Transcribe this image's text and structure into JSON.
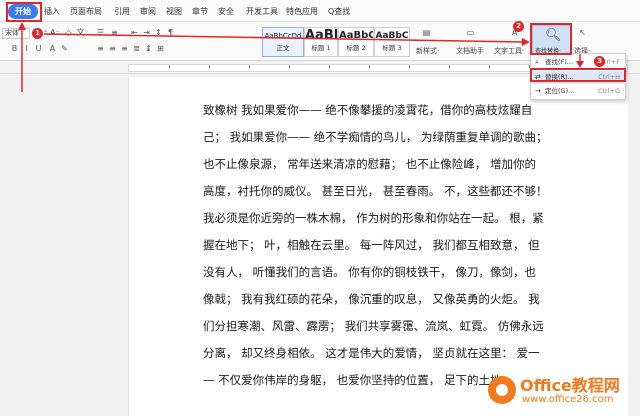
{
  "tabs": [
    "开始",
    "插入",
    "页面布局",
    "引用",
    "审阅",
    "视图",
    "章节",
    "安全",
    "开发工具",
    "特色应用"
  ],
  "search_tab": "Q查找",
  "ribbon": {
    "font_name": "宋体",
    "styles": [
      {
        "sample": "AaBbCcDd",
        "label": "正文"
      },
      {
        "sample": "AaBb",
        "label": "标题 1"
      },
      {
        "sample": "AaBbC",
        "label": "标题 2"
      },
      {
        "sample": "AaBbC",
        "label": "标题 3"
      }
    ],
    "new_style": "新样式·",
    "doc_assistant": "文档助手",
    "text_tool": "文字工具·",
    "find_replace": "查找替换·",
    "select": "选择·"
  },
  "dropdown": {
    "items": [
      {
        "icon": "search-icon",
        "label": "查找(F)...",
        "shortcut": "Ctrl+F"
      },
      {
        "icon": "replace-icon",
        "label": "替换(R)...",
        "shortcut": "Ctrl+H"
      },
      {
        "icon": "locate-icon",
        "label": "定位(G)...",
        "shortcut": "Ctrl+G"
      }
    ]
  },
  "document": {
    "lines": [
      "致橡树  我如果爱你——  绝不像攀援的凌霄花，借你的高枝炫耀自",
      "己；  我如果爱你——  绝不学痴情的鸟儿，  为绿荫重复单调的歌曲；",
      "也不止像泉源，    常年送来清凉的慰藉；  也不止像险峰，  增加你的",
      "高度，衬托你的威仪。  甚至日光，  甚至春雨。  不，这些都还不够！",
      "我必须是你近旁的一株木棉，  作为树的形象和你站在一起。  根，紧",
      "握在地下；  叶，相触在云里。  每一阵风过，  我们都互相致意，  但",
      "没有人，   听懂我们的言语。  你有你的铜枝铁干，   像刀，像剑，也",
      "像戟；  我有我红硕的花朵，  像沉重的叹息，  又像英勇的火炬。  我",
      "们分担寒潮、风雷、霹雳；  我们共享雾霭、流岚、虹霓。  仿佛永远",
      "分离，  却又终身相依。  这才是伟大的爱情，  坚贞就在这里：  爱一",
      "—  不仅爱你伟岸的身躯，  也爱你坚持的位置，   足下的土地。"
    ]
  },
  "annotations": [
    "1",
    "2",
    "3"
  ],
  "watermark": {
    "title": "Office教程网",
    "url": "www.office26.com"
  },
  "colors": {
    "accent": "#3a79ee",
    "annotation": "#e4262b",
    "watermark": "#f07a1c"
  }
}
